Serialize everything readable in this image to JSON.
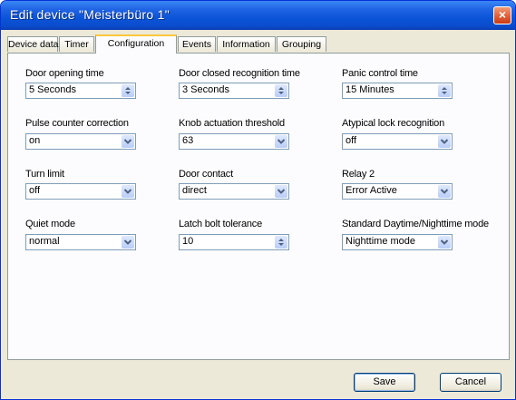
{
  "window": {
    "title": "Edit device \"Meisterbüro 1\"",
    "close_glyph": "×"
  },
  "tabs": [
    {
      "label": "Device data",
      "active": false
    },
    {
      "label": "Timer",
      "active": false
    },
    {
      "label": "Configuration",
      "active": true
    },
    {
      "label": "Events",
      "active": false
    },
    {
      "label": "Information",
      "active": false
    },
    {
      "label": "Grouping",
      "active": false
    }
  ],
  "fields": [
    {
      "label": "Door opening time",
      "value": "5 Seconds",
      "control": "spinner"
    },
    {
      "label": "Door closed recognition time",
      "value": "3 Seconds",
      "control": "spinner"
    },
    {
      "label": "Panic control time",
      "value": "15 Minutes",
      "control": "spinner"
    },
    {
      "label": "Pulse counter correction",
      "value": "on",
      "control": "dropdown"
    },
    {
      "label": "Knob actuation threshold",
      "value": "63",
      "control": "dropdown"
    },
    {
      "label": "Atypical lock recognition",
      "value": "off",
      "control": "dropdown"
    },
    {
      "label": "Turn limit",
      "value": "off",
      "control": "dropdown"
    },
    {
      "label": "Door contact",
      "value": "direct",
      "control": "dropdown"
    },
    {
      "label": "Relay 2",
      "value": "Error Active",
      "control": "dropdown"
    },
    {
      "label": "Quiet mode",
      "value": "normal",
      "control": "dropdown"
    },
    {
      "label": "Latch bolt tolerance",
      "value": "10",
      "control": "spinner"
    },
    {
      "label": "Standard Daytime/Nighttime mode",
      "value": "Nighttime mode",
      "control": "dropdown"
    }
  ],
  "footer": {
    "save_label": "Save",
    "cancel_label": "Cancel"
  },
  "icons": {
    "spinner": "spinner-arrows-icon",
    "dropdown": "chevron-down-icon",
    "close": "close-icon"
  },
  "colors": {
    "title_bar": "#0a54d8",
    "close_button": "#e2582f",
    "active_tab_highlight": "#ffc73c",
    "input_border": "#7f9db9"
  }
}
